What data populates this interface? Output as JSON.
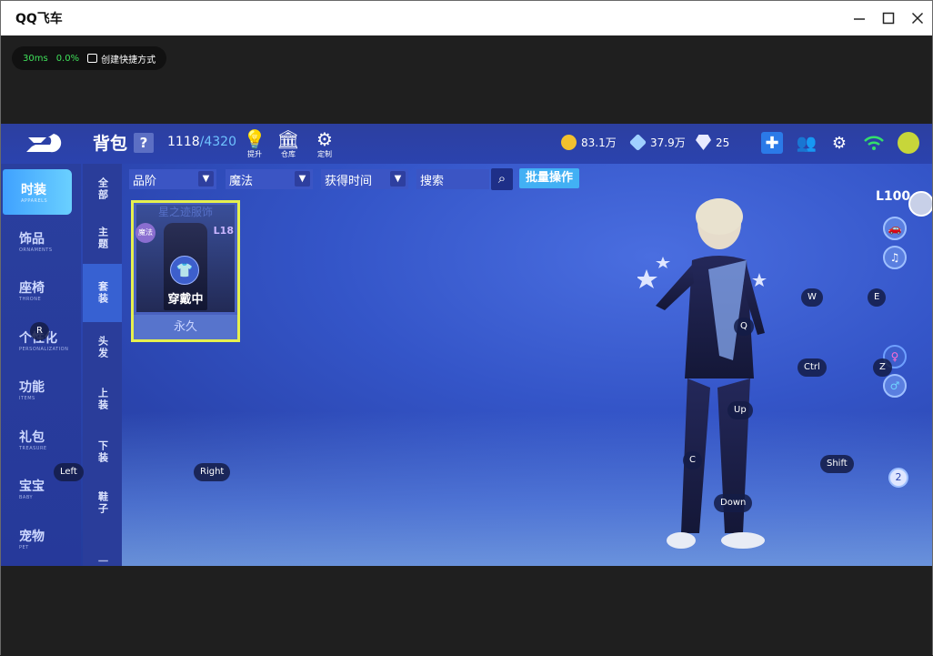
{
  "window": {
    "title": "QQ飞车",
    "controls": [
      "minimize",
      "maximize",
      "close"
    ]
  },
  "perf_bar": {
    "latency": "30ms",
    "loss": "0.0%",
    "shortcut_label": "创建快捷方式"
  },
  "game": {
    "header": {
      "title": "背包",
      "help": "?",
      "capacity_used": "1118",
      "capacity_max": "/4320",
      "tools": [
        {
          "label": "提升",
          "icon": "bulb-icon"
        },
        {
          "label": "仓库",
          "icon": "warehouse-icon"
        },
        {
          "label": "定制",
          "icon": "custom-icon"
        }
      ],
      "currencies": [
        {
          "value": "83.1万",
          "icon": "coin-icon",
          "color": "#f2c12e"
        },
        {
          "value": "37.9万",
          "icon": "voucher-icon",
          "color": "#9fd0ff"
        },
        {
          "value": "25",
          "icon": "diamond-icon",
          "color": "#e8eaff"
        }
      ]
    },
    "sidebar": {
      "items": [
        {
          "cn": "时装",
          "en": "APPARELS",
          "active": true
        },
        {
          "cn": "饰品",
          "en": "ORNAMENTS",
          "active": false
        },
        {
          "cn": "座椅",
          "en": "THRONE",
          "active": false
        },
        {
          "cn": "个性化",
          "en": "PERSONALIZATION",
          "active": false
        },
        {
          "cn": "功能",
          "en": "ITEMS",
          "active": false
        },
        {
          "cn": "礼包",
          "en": "TREASURE",
          "active": false
        },
        {
          "cn": "宝宝",
          "en": "BABY",
          "active": false
        },
        {
          "cn": "宠物",
          "en": "PET",
          "active": false
        }
      ]
    },
    "subnav": {
      "items": [
        "全部",
        "主题",
        "套装",
        "头发",
        "上装",
        "下装",
        "鞋子",
        "一"
      ],
      "active_index": 2
    },
    "filters": {
      "grade": "品阶",
      "type": "魔法",
      "sort": "获得时间",
      "search_placeholder": "搜索",
      "batch_label": "批量操作"
    },
    "items": [
      {
        "name": "星之迹服饰",
        "badge": "魔法",
        "level": "L18",
        "status": "穿戴中",
        "duration": "永久"
      }
    ],
    "right_panel": {
      "level": "L100",
      "badge_num": "2"
    },
    "key_hints": [
      "R",
      "Left",
      "Right",
      "W",
      "E",
      "Q",
      "Ctrl",
      "Z",
      "Up",
      "C",
      "Shift",
      "Down"
    ]
  }
}
